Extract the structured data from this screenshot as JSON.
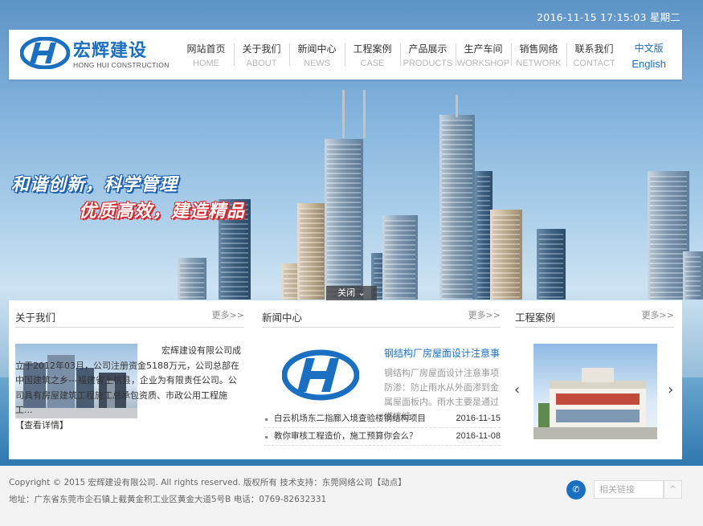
{
  "datetime": "2016-11-15 17:15:03 星期二",
  "brand": {
    "name": "宏辉建设",
    "subtitle": "HONG HUI CONSTRUCTION",
    "color": "#1b6fc0"
  },
  "nav": {
    "items": [
      {
        "cn": "网站首页",
        "en": "HOME"
      },
      {
        "cn": "关于我们",
        "en": "ABOUT"
      },
      {
        "cn": "新闻中心",
        "en": "NEWS"
      },
      {
        "cn": "工程案例",
        "en": "CASE"
      },
      {
        "cn": "产品展示",
        "en": "PRODUCTS"
      },
      {
        "cn": "生产车间",
        "en": "WORKSHOP"
      },
      {
        "cn": "销售网络",
        "en": "NETWORK"
      },
      {
        "cn": "联系我们",
        "en": "CONTACT"
      }
    ]
  },
  "lang": {
    "cn": "中文版",
    "en": "English"
  },
  "banner": {
    "slogan_line1": "和谐创新，科学管理",
    "slogan_line2": "优质高效，建造精品",
    "close_label": "关闭",
    "slogan_colors": {
      "line1": "#1c5fae",
      "line2": "#d4262b"
    }
  },
  "about": {
    "title": "关于我们",
    "more": "更多>>",
    "text": "宏辉建设有限公司成立于2012年03月，公司注册资金5188万元，公司总部在中国建筑之乡---福建省上杭县，企业为有限责任公司。公司具有房屋建筑工程施工总承包资质、市政公用工程施工...",
    "detail_link": "【查看详情】"
  },
  "news": {
    "title": "新闻中心",
    "more": "更多>>",
    "feature_title": "钢结构厂房屋面设计注意事",
    "feature_summary": "钢结构厂房屋面设计注意事项防渗：防止雨水从外面渗到金属屋面板内。雨水主要是通过搭接缝",
    "items": [
      {
        "title": "白云机场东二指廊入境查验楼钢结构项目",
        "date": "2016-11-15"
      },
      {
        "title": "教你审核工程造价，施工预算你会么？",
        "date": "2016-11-08"
      }
    ]
  },
  "cases": {
    "title": "工程案例",
    "more": "更多>>",
    "prev": "‹",
    "next": "›"
  },
  "footer": {
    "copyright": "Copyright © 2015 宏辉建设有限公司. All rights reserved. 版权所有 技术支持：东莞网络公司【动点】",
    "address": "地址：广东省东莞市企石镇上截黄金积工业区黄金大道5号B  电话：0769-82632331",
    "links_placeholder": "相关链接",
    "top_label": "^"
  }
}
